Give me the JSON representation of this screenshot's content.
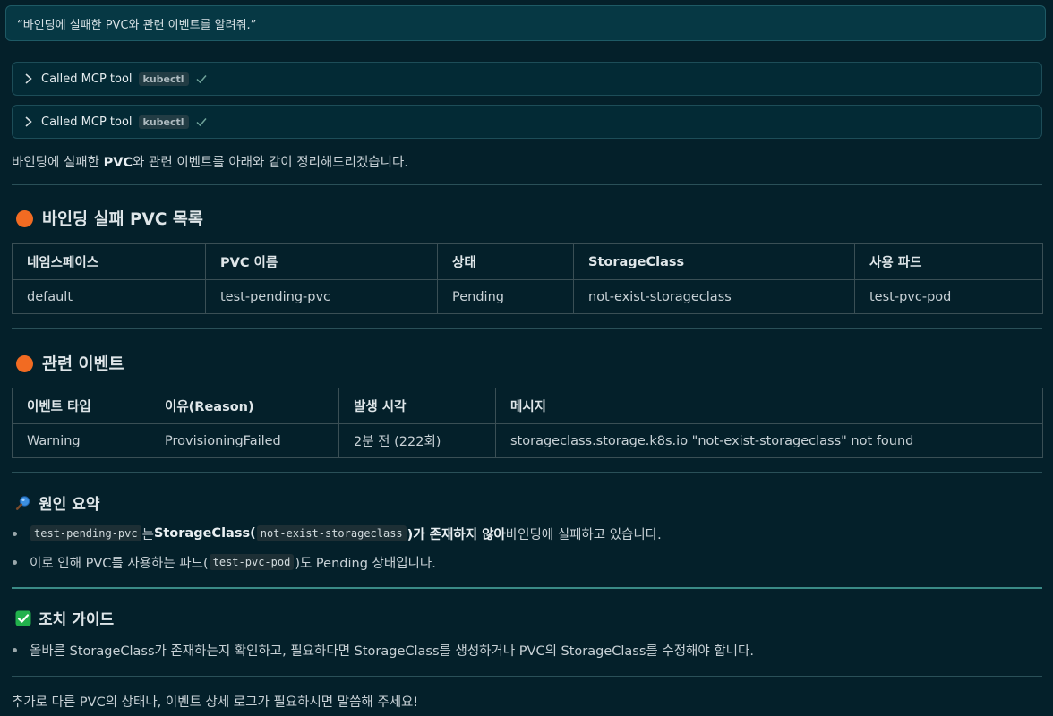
{
  "prompt": {
    "text": "“바인딩에 실패한 PVC와 관련 이벤트를 알려줘.”"
  },
  "tool_calls": [
    {
      "label": "Called MCP tool",
      "tool": "kubectl"
    },
    {
      "label": "Called MCP tool",
      "tool": "kubectl"
    }
  ],
  "intro": {
    "a": "바인딩에 실패한 ",
    "b": "PVC",
    "c": "와 관련 이벤트를 아래와 같이 정리해드리겠습니다."
  },
  "sections": {
    "pvc": {
      "title": "바인딩 실패 PVC 목록",
      "headers": [
        "네임스페이스",
        "PVC 이름",
        "상태",
        "StorageClass",
        "사용 파드"
      ],
      "rows": [
        [
          "default",
          "test-pending-pvc",
          "Pending",
          "not-exist-storageclass",
          "test-pvc-pod"
        ]
      ]
    },
    "events": {
      "title": "관련 이벤트",
      "headers": [
        "이벤트 타입",
        "이유(Reason)",
        "발생 시각",
        "메시지"
      ],
      "rows": [
        [
          "Warning",
          "ProvisioningFailed",
          "2분 전 (222회)",
          "storageclass.storage.k8s.io \"not-exist-storageclass\" not found"
        ]
      ]
    },
    "cause": {
      "title": "원인 요약",
      "item1": {
        "code1": "test-pending-pvc",
        "t1": "는 ",
        "b1": "StorageClass(",
        "code2": "not-exist-storageclass",
        "b2": ")가 존재하지 않아",
        "t2": " 바인딩에 실패하고 있습니다."
      },
      "item2": {
        "t1": "이로 인해 PVC를 사용하는 파드(",
        "code1": "test-pvc-pod",
        "t2": ")도 Pending 상태입니다."
      }
    },
    "guide": {
      "title": "조치 가이드",
      "item1": "올바른 StorageClass가 존재하는지 확인하고, 필요하다면 StorageClass를 생성하거나 PVC의 StorageClass를 수정해야 합니다."
    }
  },
  "footer": "추가로 다른 PVC의 상태나, 이벤트 상세 로그가 필요하시면 말씀해 주세요!",
  "colors": {
    "background": "#04202a",
    "accent_dot": "#f26b22",
    "check_green": "#22b14c",
    "divider_teal": "#3a8a86"
  }
}
